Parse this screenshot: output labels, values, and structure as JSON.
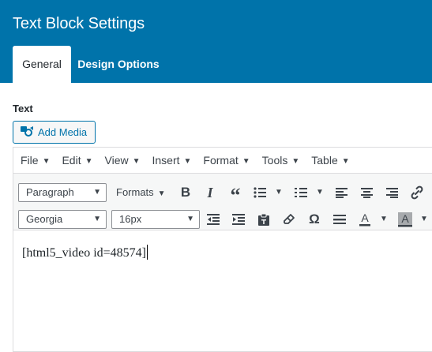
{
  "panel": {
    "title": "Text Block Settings",
    "tabs": [
      {
        "label": "General",
        "active": true
      },
      {
        "label": "Design Options",
        "active": false
      }
    ]
  },
  "field": {
    "label": "Text",
    "add_media_label": "Add Media"
  },
  "menubar": {
    "items": [
      "File",
      "Edit",
      "View",
      "Insert",
      "Format",
      "Tools",
      "Table"
    ]
  },
  "toolbar": {
    "block_format": "Paragraph",
    "formats_label": "Formats",
    "font_family": "Georgia",
    "font_size": "16px",
    "row1_icons": [
      "bold-icon",
      "italic-icon",
      "blockquote-icon",
      "bullet-list-icon",
      "numbered-list-icon",
      "align-left-icon",
      "align-center-icon",
      "align-right-icon",
      "link-icon"
    ],
    "row2_icons": [
      "outdent-icon",
      "indent-icon",
      "paste-text-icon",
      "clear-formatting-icon",
      "special-character-icon",
      "horizontal-line-icon",
      "text-color-icon",
      "background-color-icon"
    ]
  },
  "colors": {
    "header": "#0073aa",
    "accent": "#0073aa",
    "toolbar_bg": "#f6f7f7"
  },
  "editor": {
    "content": "[html5_video id=48574]"
  }
}
